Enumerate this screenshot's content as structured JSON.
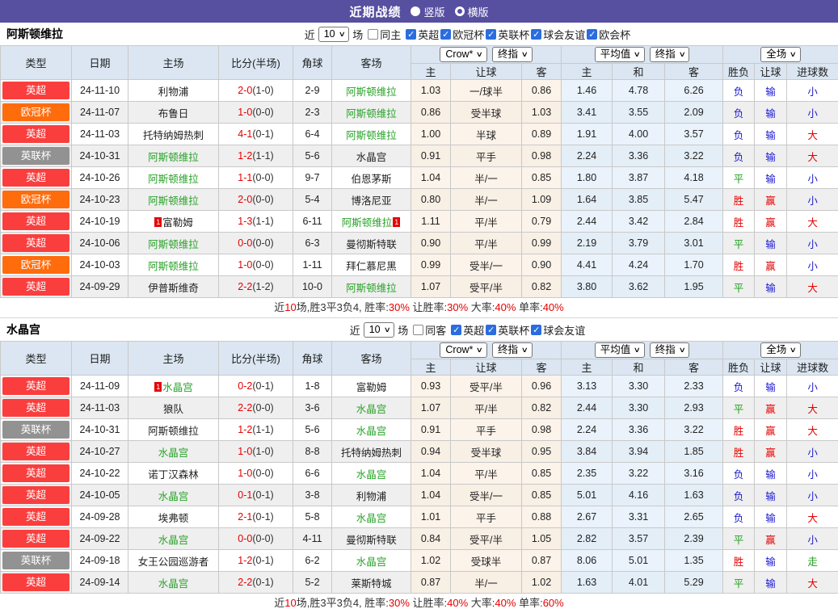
{
  "topbar": {
    "title": "近期战绩",
    "vertical_label": "竖版",
    "horizontal_label": "横版"
  },
  "colors": {
    "accent_purple": "#574fa0",
    "header_bg": "#dbe6f2",
    "odds_bg": "#fcf3ea",
    "avg_bg": "#eaf3fb",
    "checkbox_blue": "#2a6de0",
    "team_green": "#28a228",
    "score_red": "#e60000"
  },
  "league_colors": {
    "英超": "#fa3e3e",
    "欧冠杯": "#ff6c0c",
    "英联杯": "#929292"
  },
  "result_colors": {
    "胜": "#e60000",
    "平": "#1e9e1e",
    "负": "#1a1ad2",
    "赢": "#e60000",
    "输": "#1a1ad2",
    "大": "#e60000",
    "小": "#1a1ad2",
    "走": "#1e9e1e"
  },
  "table_head": {
    "columns": [
      "类型",
      "日期",
      "主场",
      "比分(半场)",
      "角球",
      "客场"
    ],
    "odds_dd1": "Crow*",
    "odds_dd2": "终指",
    "avg_dd1": "平均值",
    "avg_dd2": "终指",
    "full_dd": "全场",
    "odds_sub": [
      "主",
      "让球",
      "客"
    ],
    "avg_sub": [
      "主",
      "和",
      "客"
    ],
    "result_sub": [
      "胜负",
      "让球",
      "进球数"
    ]
  },
  "sections": [
    {
      "team": "阿斯顿维拉",
      "filter": {
        "prefix": "近",
        "games": "10",
        "suffix": "场",
        "same_label": "同主",
        "same_checked": false,
        "leagues": [
          {
            "label": "英超",
            "checked": true
          },
          {
            "label": "欧冠杯",
            "checked": true
          },
          {
            "label": "英联杯",
            "checked": true
          },
          {
            "label": "球会友谊",
            "checked": true
          },
          {
            "label": "欧会杯",
            "checked": true
          }
        ]
      },
      "rows": [
        {
          "league": "英超",
          "date": "24-11-10",
          "home": "利物浦",
          "score": "2-0",
          "half": "(1-0)",
          "corner": "2-9",
          "away": "阿斯顿维拉",
          "away_green": true,
          "odds": [
            "1.03",
            "一/球半",
            "0.86"
          ],
          "avg": [
            "1.46",
            "4.78",
            "6.26"
          ],
          "results": [
            "负",
            "输",
            "小"
          ]
        },
        {
          "league": "欧冠杯",
          "date": "24-11-07",
          "home": "布鲁日",
          "score": "1-0",
          "half": "(0-0)",
          "corner": "2-3",
          "away": "阿斯顿维拉",
          "away_green": true,
          "odds": [
            "0.86",
            "受半球",
            "1.03"
          ],
          "avg": [
            "3.41",
            "3.55",
            "2.09"
          ],
          "results": [
            "负",
            "输",
            "小"
          ]
        },
        {
          "league": "英超",
          "date": "24-11-03",
          "home": "托特纳姆热刺",
          "score": "4-1",
          "half": "(0-1)",
          "corner": "6-4",
          "away": "阿斯顿维拉",
          "away_green": true,
          "odds": [
            "1.00",
            "半球",
            "0.89"
          ],
          "avg": [
            "1.91",
            "4.00",
            "3.57"
          ],
          "results": [
            "负",
            "输",
            "大"
          ]
        },
        {
          "league": "英联杯",
          "date": "24-10-31",
          "home": "阿斯顿维拉",
          "home_green": true,
          "score": "1-2",
          "half": "(1-1)",
          "corner": "5-6",
          "away": "水晶宫",
          "odds": [
            "0.91",
            "平手",
            "0.98"
          ],
          "avg": [
            "2.24",
            "3.36",
            "3.22"
          ],
          "results": [
            "负",
            "输",
            "大"
          ]
        },
        {
          "league": "英超",
          "date": "24-10-26",
          "home": "阿斯顿维拉",
          "home_green": true,
          "score": "1-1",
          "half": "(0-0)",
          "corner": "9-7",
          "away": "伯恩茅斯",
          "odds": [
            "1.04",
            "半/一",
            "0.85"
          ],
          "avg": [
            "1.80",
            "3.87",
            "4.18"
          ],
          "results": [
            "平",
            "输",
            "小"
          ]
        },
        {
          "league": "欧冠杯",
          "date": "24-10-23",
          "home": "阿斯顿维拉",
          "home_green": true,
          "score": "2-0",
          "half": "(0-0)",
          "corner": "5-4",
          "away": "博洛尼亚",
          "odds": [
            "0.80",
            "半/一",
            "1.09"
          ],
          "avg": [
            "1.64",
            "3.85",
            "5.47"
          ],
          "results": [
            "胜",
            "赢",
            "小"
          ]
        },
        {
          "league": "英超",
          "date": "24-10-19",
          "home": "富勒姆",
          "home_mark": "1",
          "score": "1-3",
          "half": "(1-1)",
          "corner": "6-11",
          "away": "阿斯顿维拉",
          "away_green": true,
          "away_mark": "1",
          "odds": [
            "1.11",
            "平/半",
            "0.79"
          ],
          "avg": [
            "2.44",
            "3.42",
            "2.84"
          ],
          "results": [
            "胜",
            "赢",
            "大"
          ]
        },
        {
          "league": "英超",
          "date": "24-10-06",
          "home": "阿斯顿维拉",
          "home_green": true,
          "score": "0-0",
          "half": "(0-0)",
          "corner": "6-3",
          "away": "曼彻斯特联",
          "odds": [
            "0.90",
            "平/半",
            "0.99"
          ],
          "avg": [
            "2.19",
            "3.79",
            "3.01"
          ],
          "results": [
            "平",
            "输",
            "小"
          ]
        },
        {
          "league": "欧冠杯",
          "date": "24-10-03",
          "home": "阿斯顿维拉",
          "home_green": true,
          "score": "1-0",
          "half": "(0-0)",
          "corner": "1-11",
          "away": "拜仁慕尼黑",
          "odds": [
            "0.99",
            "受半/一",
            "0.90"
          ],
          "avg": [
            "4.41",
            "4.24",
            "1.70"
          ],
          "results": [
            "胜",
            "赢",
            "小"
          ]
        },
        {
          "league": "英超",
          "date": "24-09-29",
          "home": "伊普斯维奇",
          "score": "2-2",
          "half": "(1-2)",
          "corner": "10-0",
          "away": "阿斯顿维拉",
          "away_green": true,
          "odds": [
            "1.07",
            "受平/半",
            "0.82"
          ],
          "avg": [
            "3.80",
            "3.62",
            "1.95"
          ],
          "results": [
            "平",
            "输",
            "大"
          ]
        }
      ],
      "summary": [
        {
          "t": "近"
        },
        {
          "t": "10",
          "red": true
        },
        {
          "t": "场,胜3平3负4, 胜率:"
        },
        {
          "t": "30%",
          "red": true
        },
        {
          "t": " 让胜率:"
        },
        {
          "t": "30%",
          "red": true
        },
        {
          "t": " 大率:"
        },
        {
          "t": "40%",
          "red": true
        },
        {
          "t": " 单率:"
        },
        {
          "t": "40%",
          "red": true
        }
      ]
    },
    {
      "team": "水晶宫",
      "filter": {
        "prefix": "近",
        "games": "10",
        "suffix": "场",
        "same_label": "同客",
        "same_checked": false,
        "leagues": [
          {
            "label": "英超",
            "checked": true
          },
          {
            "label": "英联杯",
            "checked": true
          },
          {
            "label": "球会友谊",
            "checked": true
          }
        ]
      },
      "rows": [
        {
          "league": "英超",
          "date": "24-11-09",
          "home": "水晶宫",
          "home_green": true,
          "home_mark": "1",
          "score": "0-2",
          "half": "(0-1)",
          "corner": "1-8",
          "away": "富勒姆",
          "odds": [
            "0.93",
            "受平/半",
            "0.96"
          ],
          "avg": [
            "3.13",
            "3.30",
            "2.33"
          ],
          "results": [
            "负",
            "输",
            "小"
          ]
        },
        {
          "league": "英超",
          "date": "24-11-03",
          "home": "狼队",
          "score": "2-2",
          "half": "(0-0)",
          "corner": "3-6",
          "away": "水晶宫",
          "away_green": true,
          "odds": [
            "1.07",
            "平/半",
            "0.82"
          ],
          "avg": [
            "2.44",
            "3.30",
            "2.93"
          ],
          "results": [
            "平",
            "赢",
            "大"
          ]
        },
        {
          "league": "英联杯",
          "date": "24-10-31",
          "home": "阿斯顿维拉",
          "score": "1-2",
          "half": "(1-1)",
          "corner": "5-6",
          "away": "水晶宫",
          "away_green": true,
          "odds": [
            "0.91",
            "平手",
            "0.98"
          ],
          "avg": [
            "2.24",
            "3.36",
            "3.22"
          ],
          "results": [
            "胜",
            "赢",
            "大"
          ]
        },
        {
          "league": "英超",
          "date": "24-10-27",
          "home": "水晶宫",
          "home_green": true,
          "score": "1-0",
          "half": "(1-0)",
          "corner": "8-8",
          "away": "托特纳姆热刺",
          "odds": [
            "0.94",
            "受半球",
            "0.95"
          ],
          "avg": [
            "3.84",
            "3.94",
            "1.85"
          ],
          "results": [
            "胜",
            "赢",
            "小"
          ]
        },
        {
          "league": "英超",
          "date": "24-10-22",
          "home": "诺丁汉森林",
          "score": "1-0",
          "half": "(0-0)",
          "corner": "6-6",
          "away": "水晶宫",
          "away_green": true,
          "odds": [
            "1.04",
            "平/半",
            "0.85"
          ],
          "avg": [
            "2.35",
            "3.22",
            "3.16"
          ],
          "results": [
            "负",
            "输",
            "小"
          ]
        },
        {
          "league": "英超",
          "date": "24-10-05",
          "home": "水晶宫",
          "home_green": true,
          "score": "0-1",
          "half": "(0-1)",
          "corner": "3-8",
          "away": "利物浦",
          "odds": [
            "1.04",
            "受半/一",
            "0.85"
          ],
          "avg": [
            "5.01",
            "4.16",
            "1.63"
          ],
          "results": [
            "负",
            "输",
            "小"
          ]
        },
        {
          "league": "英超",
          "date": "24-09-28",
          "home": "埃弗顿",
          "score": "2-1",
          "half": "(0-1)",
          "corner": "5-8",
          "away": "水晶宫",
          "away_green": true,
          "odds": [
            "1.01",
            "平手",
            "0.88"
          ],
          "avg": [
            "2.67",
            "3.31",
            "2.65"
          ],
          "results": [
            "负",
            "输",
            "大"
          ]
        },
        {
          "league": "英超",
          "date": "24-09-22",
          "home": "水晶宫",
          "home_green": true,
          "score": "0-0",
          "half": "(0-0)",
          "corner": "4-11",
          "away": "曼彻斯特联",
          "odds": [
            "0.84",
            "受平/半",
            "1.05"
          ],
          "avg": [
            "2.82",
            "3.57",
            "2.39"
          ],
          "results": [
            "平",
            "赢",
            "小"
          ]
        },
        {
          "league": "英联杯",
          "date": "24-09-18",
          "home": "女王公园巡游者",
          "score": "1-2",
          "half": "(0-1)",
          "corner": "6-2",
          "away": "水晶宫",
          "away_green": true,
          "odds": [
            "1.02",
            "受球半",
            "0.87"
          ],
          "avg": [
            "8.06",
            "5.01",
            "1.35"
          ],
          "results": [
            "胜",
            "输",
            "走"
          ]
        },
        {
          "league": "英超",
          "date": "24-09-14",
          "home": "水晶宫",
          "home_green": true,
          "score": "2-2",
          "half": "(0-1)",
          "corner": "5-2",
          "away": "莱斯特城",
          "odds": [
            "0.87",
            "半/一",
            "1.02"
          ],
          "avg": [
            "1.63",
            "4.01",
            "5.29"
          ],
          "results": [
            "平",
            "输",
            "大"
          ]
        }
      ],
      "summary": [
        {
          "t": "近"
        },
        {
          "t": "10",
          "red": true
        },
        {
          "t": "场,胜3平3负4, 胜率:"
        },
        {
          "t": "30%",
          "red": true
        },
        {
          "t": " 让胜率:"
        },
        {
          "t": "40%",
          "red": true
        },
        {
          "t": " 大率:"
        },
        {
          "t": "40%",
          "red": true
        },
        {
          "t": " 单率:"
        },
        {
          "t": "60%",
          "red": true
        }
      ]
    }
  ]
}
